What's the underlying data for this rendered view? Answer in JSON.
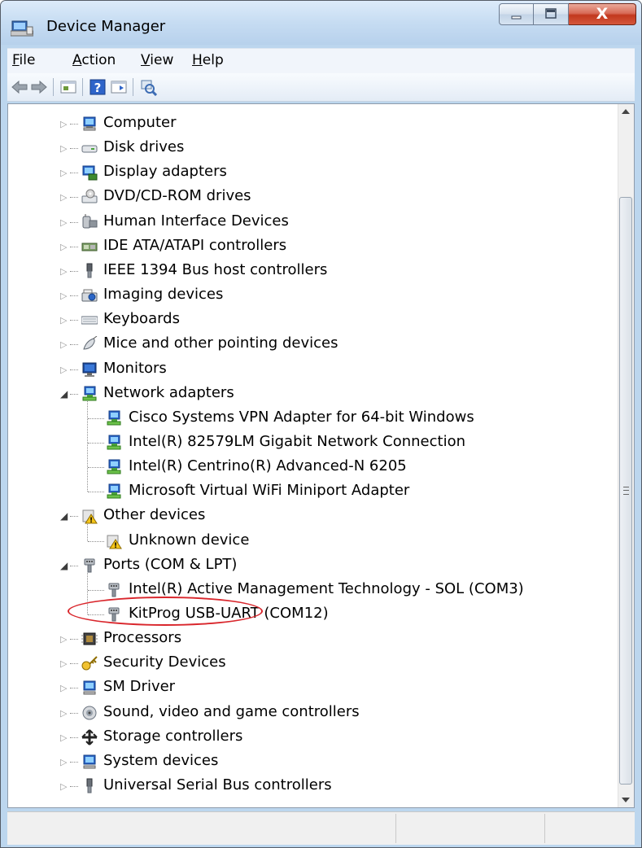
{
  "window": {
    "title": "Device Manager",
    "close_glyph": "X"
  },
  "menu": [
    "File",
    "Action",
    "View",
    "Help"
  ],
  "menu_mnemonics": [
    "F",
    "A",
    "V",
    "H"
  ],
  "toolbar_icons": [
    "back-arrow-icon",
    "forward-arrow-icon",
    "properties-icon",
    "help-icon",
    "run-icon",
    "scan-hardware-icon"
  ],
  "tree": {
    "categories": [
      {
        "label": "Computer",
        "expanded": false,
        "icon": "computer-icon"
      },
      {
        "label": "Disk drives",
        "expanded": false,
        "icon": "disk-drive-icon"
      },
      {
        "label": "Display adapters",
        "expanded": false,
        "icon": "display-adapter-icon"
      },
      {
        "label": "DVD/CD-ROM drives",
        "expanded": false,
        "icon": "dvd-drive-icon"
      },
      {
        "label": "Human Interface Devices",
        "expanded": false,
        "icon": "hid-icon"
      },
      {
        "label": "IDE ATA/ATAPI controllers",
        "expanded": false,
        "icon": "ide-controller-icon"
      },
      {
        "label": "IEEE 1394 Bus host controllers",
        "expanded": false,
        "icon": "ieee1394-icon"
      },
      {
        "label": "Imaging devices",
        "expanded": false,
        "icon": "imaging-device-icon"
      },
      {
        "label": "Keyboards",
        "expanded": false,
        "icon": "keyboard-icon"
      },
      {
        "label": "Mice and other pointing devices",
        "expanded": false,
        "icon": "mouse-icon"
      },
      {
        "label": "Monitors",
        "expanded": false,
        "icon": "monitor-icon"
      },
      {
        "label": "Network adapters",
        "expanded": true,
        "icon": "network-adapter-icon",
        "children": [
          "Cisco Systems VPN Adapter for 64-bit Windows",
          "Intel(R) 82579LM Gigabit Network Connection",
          "Intel(R) Centrino(R) Advanced-N 6205",
          "Microsoft Virtual WiFi Miniport Adapter"
        ]
      },
      {
        "label": "Other devices",
        "expanded": true,
        "icon": "other-devices-icon",
        "children": [
          "Unknown device"
        ]
      },
      {
        "label": "Ports (COM & LPT)",
        "expanded": true,
        "icon": "port-icon",
        "children": [
          "Intel(R) Active Management Technology - SOL (COM3)",
          "KitProg USB-UART (COM12)"
        ]
      },
      {
        "label": "Processors",
        "expanded": false,
        "icon": "processor-icon"
      },
      {
        "label": "Security Devices",
        "expanded": false,
        "icon": "security-device-icon"
      },
      {
        "label": "SM Driver",
        "expanded": false,
        "icon": "sm-driver-icon"
      },
      {
        "label": "Sound, video and game controllers",
        "expanded": false,
        "icon": "sound-icon"
      },
      {
        "label": "Storage controllers",
        "expanded": false,
        "icon": "storage-controller-icon"
      },
      {
        "label": "System devices",
        "expanded": false,
        "icon": "system-device-icon"
      },
      {
        "label": "Universal Serial Bus controllers",
        "expanded": false,
        "icon": "usb-icon"
      }
    ]
  },
  "colors": {
    "highlight": "#d9262c",
    "frame": "#bcd6ee"
  }
}
